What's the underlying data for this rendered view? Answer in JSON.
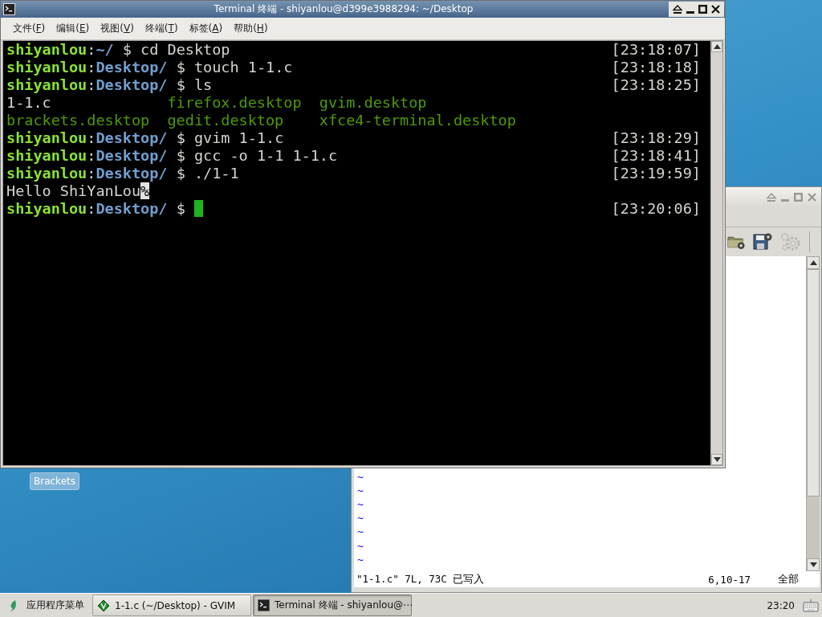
{
  "terminal_window": {
    "title": "Terminal 终端 - shiyanlou@d399e3988294: ~/Desktop",
    "menu": [
      {
        "label": "文件(",
        "mnemonic": "F",
        "after": ")"
      },
      {
        "label": "编辑(",
        "mnemonic": "E",
        "after": ")"
      },
      {
        "label": "视图(",
        "mnemonic": "V",
        "after": ")"
      },
      {
        "label": "终端(",
        "mnemonic": "T",
        "after": ")"
      },
      {
        "label": "标签(",
        "mnemonic": "A",
        "after": ")"
      },
      {
        "label": "帮助(",
        "mnemonic": "H",
        "after": ")"
      }
    ],
    "lines": [
      {
        "kind": "prompt",
        "user": "shiyanlou",
        "separator": ":",
        "path": "~/",
        "symbol": "$",
        "command": "cd Desktop",
        "time": "[23:18:07]",
        "cursor": false
      },
      {
        "kind": "prompt",
        "user": "shiyanlou",
        "separator": ":",
        "path": "Desktop/",
        "symbol": "$",
        "command": "touch 1-1.c",
        "time": "[23:18:18]",
        "cursor": false
      },
      {
        "kind": "prompt",
        "user": "shiyanlou",
        "separator": ":",
        "path": "Desktop/",
        "symbol": "$",
        "command": "ls",
        "time": "[23:18:25]",
        "cursor": false
      },
      {
        "kind": "listing",
        "entries": [
          {
            "name": "1-1.c",
            "color": "#d3d7cf"
          },
          {
            "name": "firefox.desktop",
            "color": "#4e9a06"
          },
          {
            "name": "gvim.desktop",
            "color": "#4e9a06"
          }
        ]
      },
      {
        "kind": "listing",
        "entries": [
          {
            "name": "brackets.desktop",
            "color": "#4e9a06"
          },
          {
            "name": "gedit.desktop",
            "color": "#4e9a06"
          },
          {
            "name": "xfce4-terminal.desktop",
            "color": "#4e9a06"
          }
        ]
      },
      {
        "kind": "prompt",
        "user": "shiyanlou",
        "separator": ":",
        "path": "Desktop/",
        "symbol": "$",
        "command": "gvim 1-1.c",
        "time": "[23:18:29]",
        "cursor": false
      },
      {
        "kind": "prompt",
        "user": "shiyanlou",
        "separator": ":",
        "path": "Desktop/",
        "symbol": "$",
        "command": "gcc -o 1-1 1-1.c",
        "time": "[23:18:41]",
        "cursor": false
      },
      {
        "kind": "prompt",
        "user": "shiyanlou",
        "separator": ":",
        "path": "Desktop/",
        "symbol": "$",
        "command": "./1-1",
        "time": "[23:19:59]",
        "cursor": false
      },
      {
        "kind": "output",
        "segments": [
          {
            "text": "Hello ShiYanLou",
            "highlighted": false
          },
          {
            "text": "%",
            "highlighted": true
          }
        ]
      },
      {
        "kind": "prompt",
        "user": "shiyanlou",
        "separator": ":",
        "path": "Desktop/",
        "symbol": "$",
        "time": "[23:20:06]",
        "cursor": true
      }
    ]
  },
  "gvim_window": {
    "empty_lines": [
      "~",
      "~",
      "~",
      "~",
      "~",
      "~",
      "~"
    ],
    "status_message": "\"1-1.c\" 7L, 73C 已写入",
    "cursor_position": "6,10-17",
    "scroll_position": "全部"
  },
  "desktop_icons": [
    {
      "label": "Brackets",
      "selected": true
    }
  ],
  "taskbar": {
    "app_menu": "应用程序菜单",
    "tasks": [
      {
        "kind": "gvim",
        "label": "1-1.c (~/Desktop) - GVIM",
        "selected": false
      },
      {
        "kind": "terminal",
        "label": "Terminal 终端 - shiyanlou@⋯",
        "selected": true
      }
    ],
    "clock": "23:20"
  }
}
